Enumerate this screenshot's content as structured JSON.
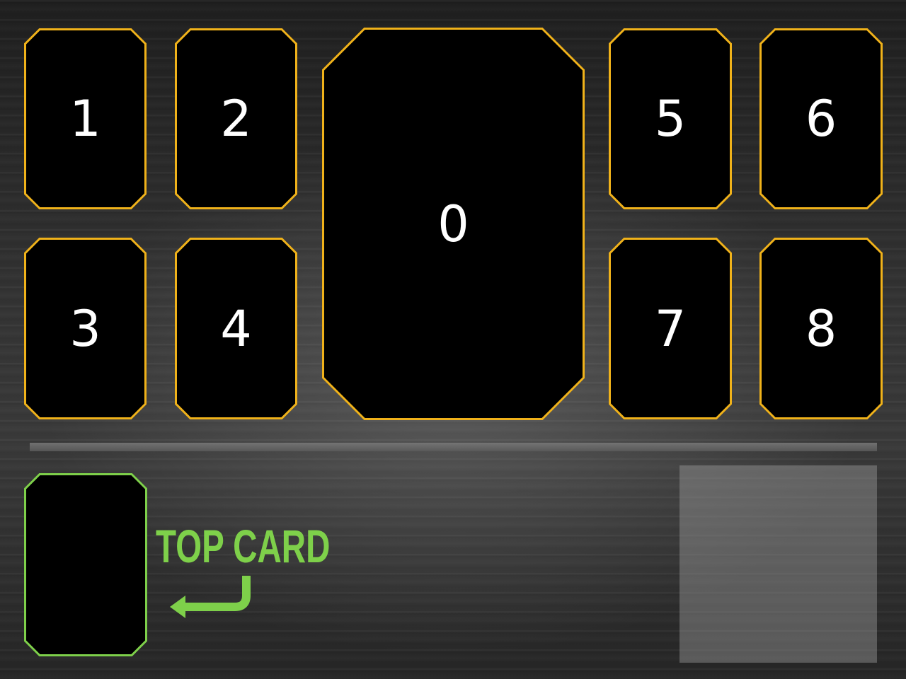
{
  "board": {
    "slot_border_color": "#f0b21a",
    "top_card_color": "#7ed04a",
    "slots": [
      {
        "label": "1"
      },
      {
        "label": "2"
      },
      {
        "label": "0"
      },
      {
        "label": "5"
      },
      {
        "label": "6"
      },
      {
        "label": "3"
      },
      {
        "label": "4"
      },
      {
        "label": "7"
      },
      {
        "label": "8"
      }
    ]
  },
  "deck": {
    "label": "TOP CARD",
    "arrow_icon": "return-arrow-icon"
  }
}
